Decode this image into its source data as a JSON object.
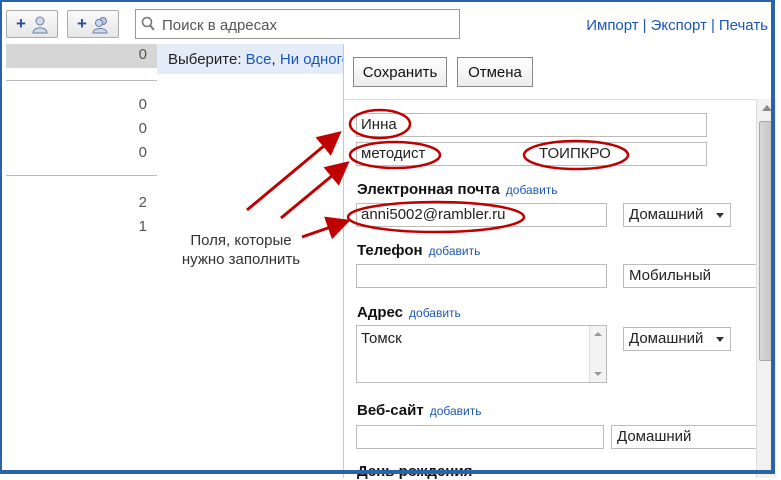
{
  "toolbar": {
    "search_placeholder": "Поиск в адресах",
    "links": [
      "Импорт",
      "Экспорт",
      "Печать"
    ],
    "add_contact_icon": "add-contact-icon",
    "add_group_icon": "add-group-icon"
  },
  "sidebar": {
    "groups": [
      {
        "label": "",
        "count": "0",
        "selected": true
      },
      {
        "label": "",
        "count": "0"
      },
      {
        "label": "",
        "count": "0"
      },
      {
        "label": "",
        "count": "0"
      },
      {
        "label": "",
        "count": "2"
      },
      {
        "label": "",
        "count": "1"
      }
    ]
  },
  "middle": {
    "select_prefix": "Выберите:",
    "select_all": "Все",
    "select_none": "Ни одного",
    "annotation_line1": "Поля, которые",
    "annotation_line2": "нужно заполнить"
  },
  "editor": {
    "save_label": "Сохранить",
    "cancel_label": "Отмена",
    "name_value": "Инна",
    "title_value": "методист",
    "company_value": "ТОИПКРО",
    "email_label": "Электронная почта",
    "email_value": "anni5002@rambler.ru",
    "email_type": "Домашний",
    "phone_label": "Телефон",
    "phone_value": "",
    "phone_type": "Мобильный",
    "address_label": "Адрес",
    "address_value": "Томск",
    "address_type": "Домашний",
    "website_label": "Веб-сайт",
    "website_value": "",
    "website_type": "Домашний",
    "birthday_label": "День рождения",
    "add_label": "добавить"
  },
  "colors": {
    "link": "#1c56b8",
    "annotation_red": "#c00000",
    "frame_blue": "#2b63a8"
  }
}
